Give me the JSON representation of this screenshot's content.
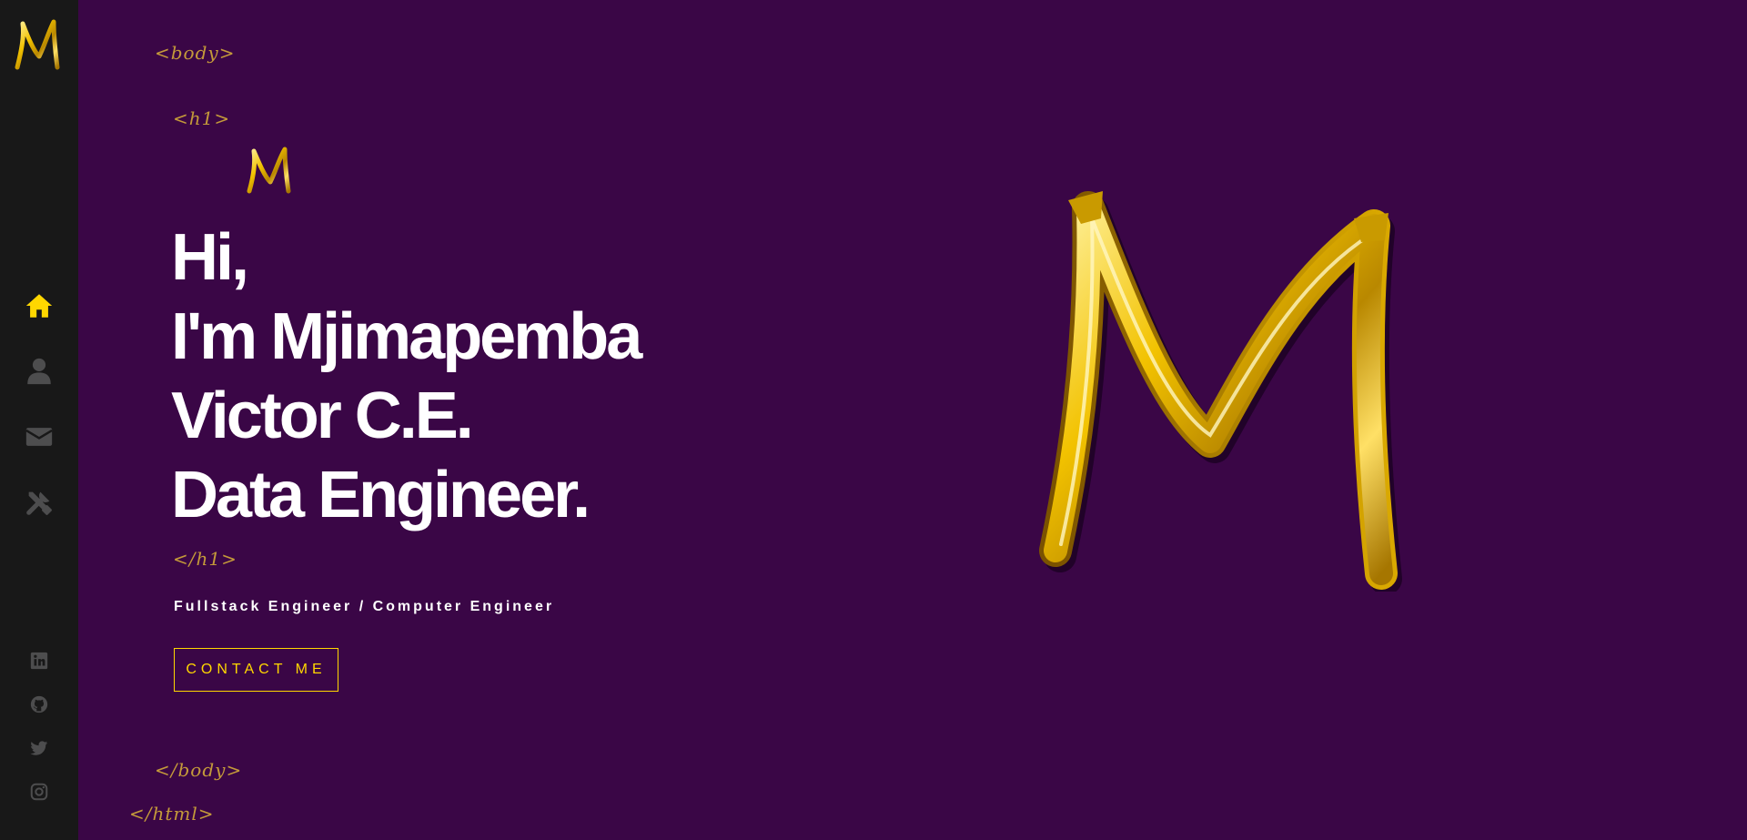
{
  "sidebar": {
    "logo_icon": "gold-m-logo-icon",
    "nav_items": [
      {
        "icon": "home-icon",
        "active": true
      },
      {
        "icon": "user-icon",
        "active": false
      },
      {
        "icon": "envelope-icon",
        "active": false
      },
      {
        "icon": "tools-icon",
        "active": false
      }
    ],
    "social_items": [
      {
        "icon": "linkedin-icon"
      },
      {
        "icon": "github-icon"
      },
      {
        "icon": "twitter-icon"
      },
      {
        "icon": "instagram-icon"
      }
    ]
  },
  "tags": {
    "body_open": "<body>",
    "h1_open": "<h1>",
    "h1_close": "</h1>",
    "body_close": "</body>",
    "html_close": "</html>"
  },
  "hero": {
    "line1": "Hi,",
    "line2": "I'm Mjimapemba",
    "line3": "Victor C.E.",
    "line4": "Data Engineer.",
    "subtitle": "Fullstack Engineer / Computer Engineer",
    "contact_label": "CONTACT ME"
  },
  "colors": {
    "background": "#3a0646",
    "sidebar": "#181818",
    "accent": "#ffd700",
    "tag": "#c49a3a",
    "nav_inactive": "#4d4d4e"
  }
}
